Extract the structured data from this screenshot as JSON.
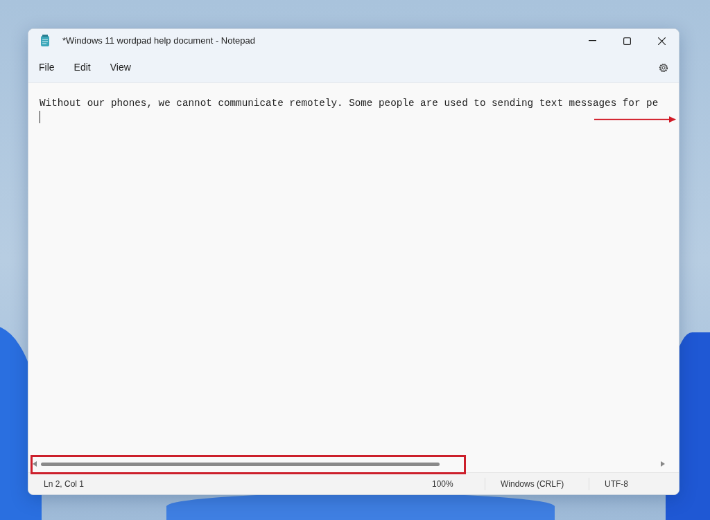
{
  "window": {
    "title": "*Windows 11 wordpad help document - Notepad"
  },
  "menu": [
    "File",
    "Edit",
    "View"
  ],
  "editor": {
    "lines": [
      "Without our phones, we cannot communicate remotely. Some people are used to sending text messages for pe"
    ]
  },
  "status_bar": {
    "position": "Ln 2, Col 1",
    "zoom": "100%",
    "line_ending": "Windows (CRLF)",
    "encoding": "UTF-8"
  }
}
